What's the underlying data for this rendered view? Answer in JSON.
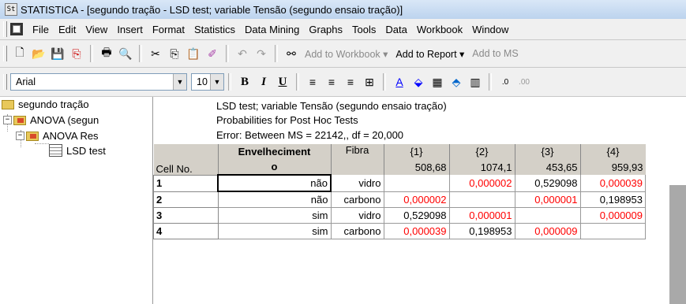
{
  "window": {
    "title": "STATISTICA - [segundo tração - LSD test; variable Tensão (segundo ensaio tração)]"
  },
  "menu": [
    "File",
    "Edit",
    "View",
    "Insert",
    "Format",
    "Statistics",
    "Data Mining",
    "Graphs",
    "Tools",
    "Data",
    "Workbook",
    "Window"
  ],
  "toolbar1": {
    "add_to_workbook": "Add to Workbook ▾",
    "add_to_report": "Add to Report ▾",
    "add_to_ms": "Add to MS"
  },
  "toolbar2": {
    "font": "Arial",
    "size": "10"
  },
  "tree": {
    "root": "segundo tração",
    "anova1": "ANOVA (segun",
    "anova2": "ANOVA Res",
    "lsd": "LSD test"
  },
  "grid": {
    "title1": "LSD test; variable Tensão (segundo ensaio tração)",
    "title2": "Probabilities for Post Hoc Tests",
    "title3": "Error: Between MS = 22142,, df = 20,000",
    "header_cellno": "Cell No.",
    "header_env1": "Envelheciment",
    "header_env2": "o",
    "header_fibra": "Fibra",
    "cols": [
      {
        "id": "{1}",
        "mean": "508,68"
      },
      {
        "id": "{2}",
        "mean": "1074,1"
      },
      {
        "id": "{3}",
        "mean": "453,65"
      },
      {
        "id": "{4}",
        "mean": "959,93"
      }
    ],
    "rows": [
      {
        "n": "1",
        "env": "não",
        "fibra": "vidro",
        "v": [
          "",
          "0,000002",
          "0,529098",
          "0,000039"
        ]
      },
      {
        "n": "2",
        "env": "não",
        "fibra": "carbono",
        "v": [
          "0,000002",
          "",
          "0,000001",
          "0,198953"
        ]
      },
      {
        "n": "3",
        "env": "sim",
        "fibra": "vidro",
        "v": [
          "0,529098",
          "0,000001",
          "",
          "0,000009"
        ]
      },
      {
        "n": "4",
        "env": "sim",
        "fibra": "carbono",
        "v": [
          "0,000039",
          "0,198953",
          "0,000009",
          ""
        ]
      }
    ]
  },
  "colors": {
    "significant": "#ff0000",
    "titlebar": "#bcd3ee"
  }
}
